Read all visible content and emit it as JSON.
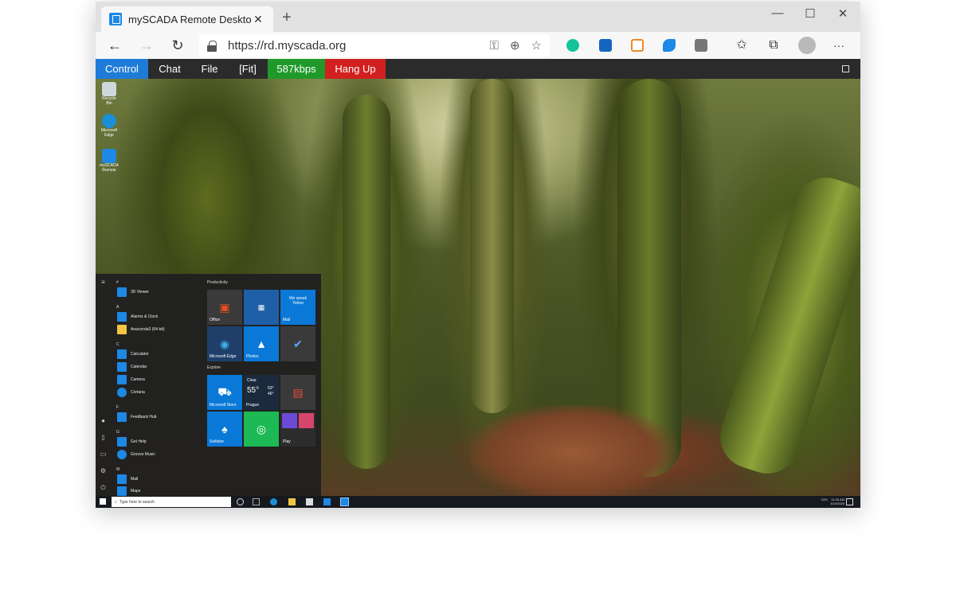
{
  "browser": {
    "tab_title": "mySCADA Remote Desktop View",
    "tab_close": "✕",
    "new_tab": "+",
    "window_controls": {
      "minimize": "—",
      "maximize": "☐",
      "close": "✕"
    },
    "nav": {
      "back": "←",
      "forward": "→",
      "refresh": "↻"
    },
    "url": "https://rd.myscada.org",
    "url_icons": {
      "key": "⚿",
      "zoom": "⊕",
      "favorite": "☆"
    },
    "toolbar_icons": {
      "favorites": "✩",
      "collections": "⧉",
      "more": "···"
    }
  },
  "remote_toolbar": {
    "buttons": [
      {
        "label": "Control",
        "color": "#1e7bd8"
      },
      {
        "label": "Chat",
        "color": "#2b2b2b"
      },
      {
        "label": "File",
        "color": "#2b2b2b"
      },
      {
        "label": "[Fit]",
        "color": "#2b2b2b"
      },
      {
        "label": "587kbps",
        "color": "#1f9a2a"
      },
      {
        "label": "Hang Up",
        "color": "#d21f1f"
      }
    ]
  },
  "desktop": {
    "icons": [
      {
        "label": "Recycle Bin"
      },
      {
        "label": "Microsoft Edge"
      },
      {
        "label": "mySCADA Remote"
      }
    ]
  },
  "start_menu": {
    "rail_icons": [
      "≡",
      "●",
      "▯",
      "▭",
      "⚙",
      "⏻"
    ],
    "letters": [
      "#",
      "A",
      "C",
      "F",
      "G",
      "M"
    ],
    "apps": [
      {
        "label": "3D Viewer",
        "color": "#1e88e5"
      },
      {
        "label": "Alarms & Clock",
        "color": "#1e88e5"
      },
      {
        "label": "Anaconda3 (64-bit)",
        "color": "#f5c542"
      },
      {
        "label": "Calculator",
        "color": "#1e88e5"
      },
      {
        "label": "Calendar",
        "color": "#1e88e5"
      },
      {
        "label": "Camera",
        "color": "#1e88e5"
      },
      {
        "label": "Cortana",
        "color": "#1e88e5"
      },
      {
        "label": "Feedback Hub",
        "color": "#1e88e5"
      },
      {
        "label": "Get Help",
        "color": "#1e88e5"
      },
      {
        "label": "Groove Music",
        "color": "#1e88e5"
      },
      {
        "label": "Mail",
        "color": "#1e88e5"
      },
      {
        "label": "Maps",
        "color": "#1e88e5"
      }
    ],
    "groups": {
      "productivity": "Productivity",
      "explore": "Explore"
    },
    "tiles": {
      "office": "Office",
      "mail": "Mail",
      "mail_promo": "We speak Yahoo",
      "edge": "Microsoft Edge",
      "photos": "Photos",
      "store": "Microsoft Store",
      "weather_cond": "Clear",
      "weather_temp": "55°",
      "weather_hi": "63°",
      "weather_lo": "46°",
      "weather_city": "Prague",
      "solitaire": "Solitaire",
      "play": "Play"
    }
  },
  "taskbar": {
    "search_placeholder": "Type here to search",
    "time": "11:26 AM",
    "date": "10/4/2020",
    "lang": "CES"
  }
}
